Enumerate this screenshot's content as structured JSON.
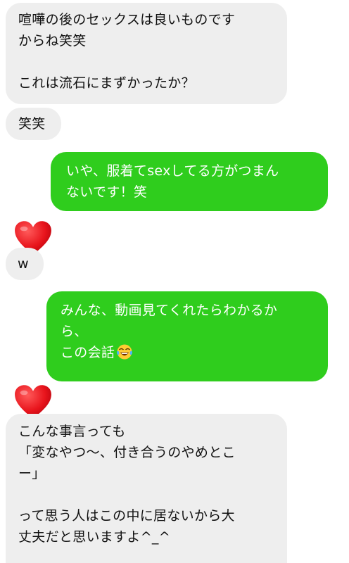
{
  "messages": [
    {
      "id": "m1",
      "direction": "incoming",
      "lines": [
        "喧嘩の後のセックスは良いものです",
        "からね笑笑",
        "",
        "これは流石にまずかったか？"
      ]
    },
    {
      "id": "m2",
      "direction": "incoming",
      "lines": [
        "笑笑"
      ]
    },
    {
      "id": "m3",
      "direction": "outgoing",
      "lines": [
        "いや、服着てsexしてる方がつまん",
        "ないです！笑"
      ]
    },
    {
      "id": "m4",
      "direction": "incoming",
      "lines": [
        "w"
      ],
      "reaction": "heart-icon"
    },
    {
      "id": "m5",
      "direction": "outgoing",
      "lines": [
        "みんな、動画見てくれたらわかるか",
        "ら、",
        "この会話"
      ],
      "emoji": "tears-of-joy-emoji-icon"
    },
    {
      "id": "m6",
      "direction": "incoming",
      "lines": [
        "こんな事言っても",
        "「変なやつ〜、付き合うのやめとこ",
        "ー」",
        "",
        "って思う人はこの中に居ないから大",
        "丈夫だと思いますよ^_^"
      ],
      "reaction": "heart-icon"
    }
  ],
  "colors": {
    "incoming_bubble": "#eeeeee",
    "outgoing_bubble": "#2fcd1d",
    "heart": "#e8141c"
  }
}
